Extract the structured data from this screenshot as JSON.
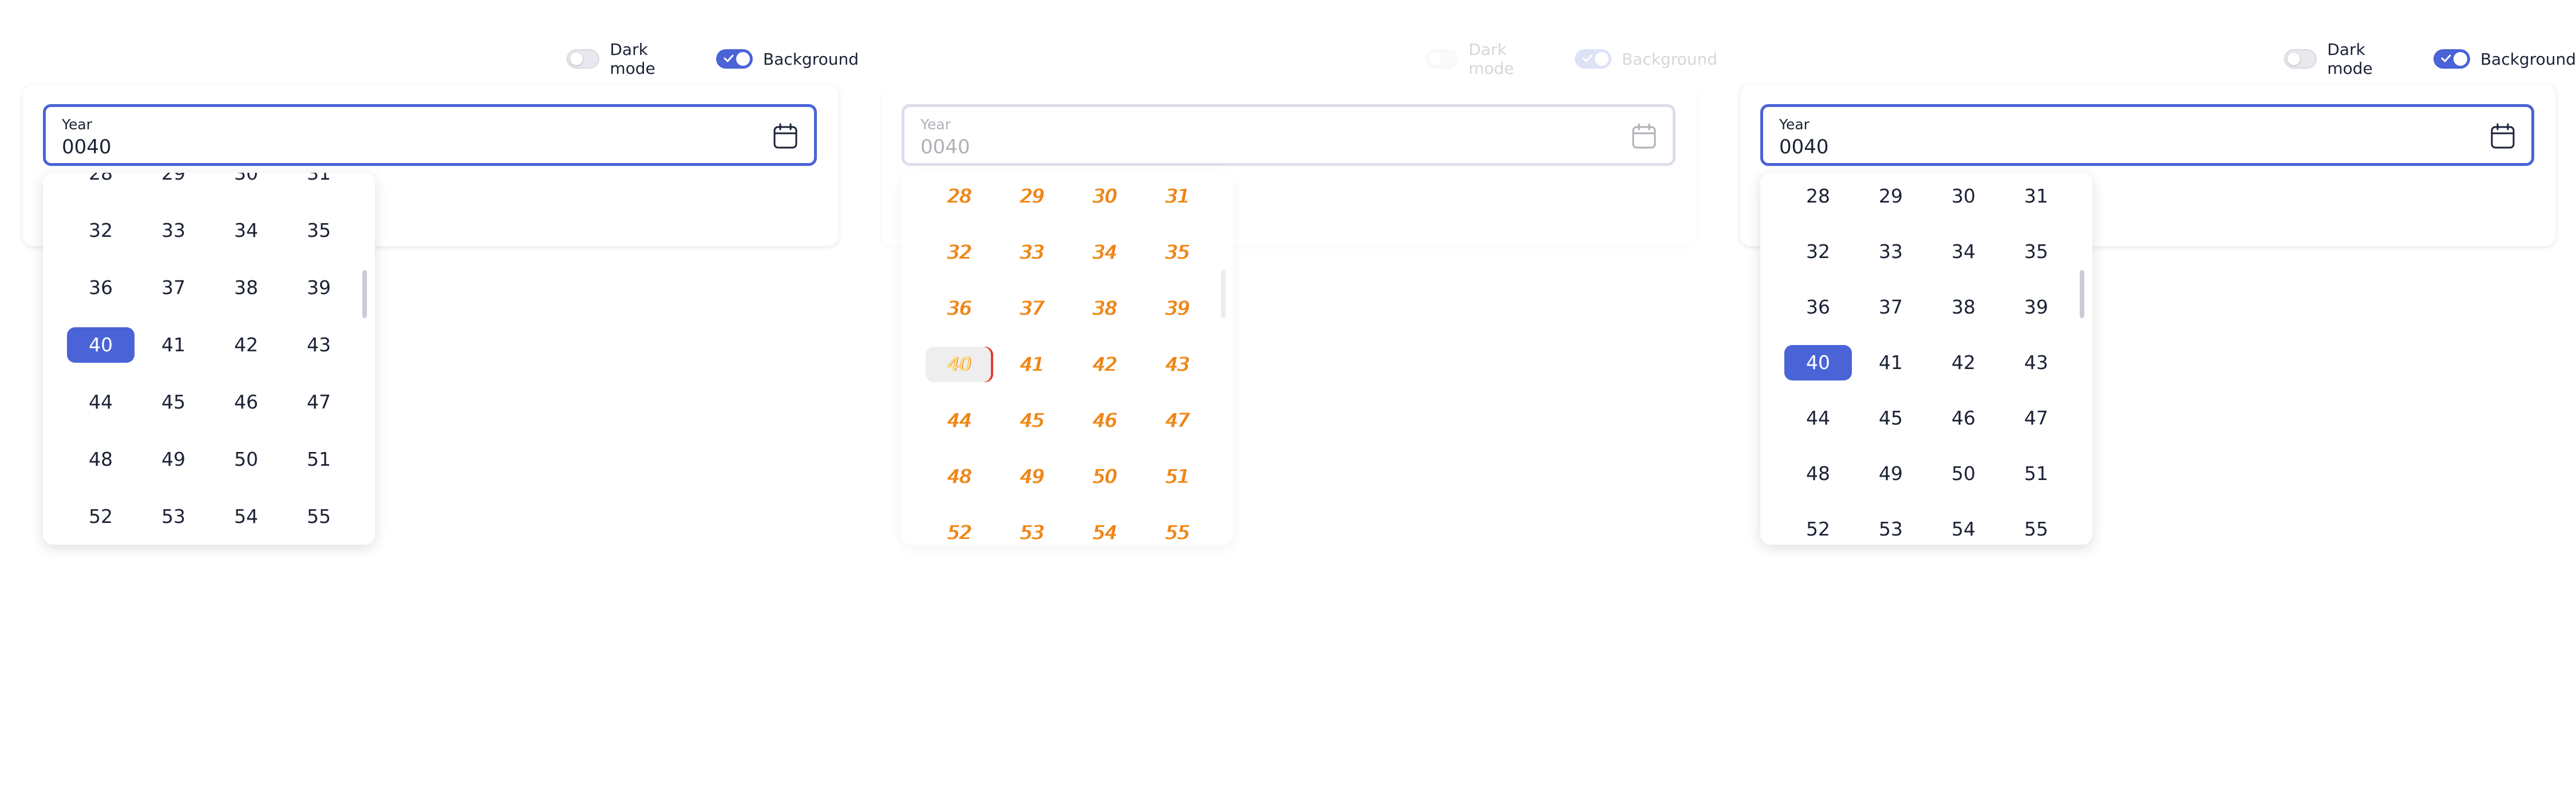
{
  "toggles": {
    "dark_mode_label": "Dark mode",
    "background_label": "Background",
    "dark_mode_on": false,
    "background_on": true
  },
  "field": {
    "label": "Year",
    "value": "0040"
  },
  "years": [
    "28",
    "29",
    "30",
    "31",
    "32",
    "33",
    "34",
    "35",
    "36",
    "37",
    "38",
    "39",
    "40",
    "41",
    "42",
    "43",
    "44",
    "45",
    "46",
    "47",
    "48",
    "49",
    "50",
    "51",
    "52",
    "53",
    "54",
    "55"
  ],
  "selected_year": "40",
  "colors": {
    "accent": "#4a63d6",
    "text": "#1b2235",
    "glitch_orange": "#f08a14"
  }
}
